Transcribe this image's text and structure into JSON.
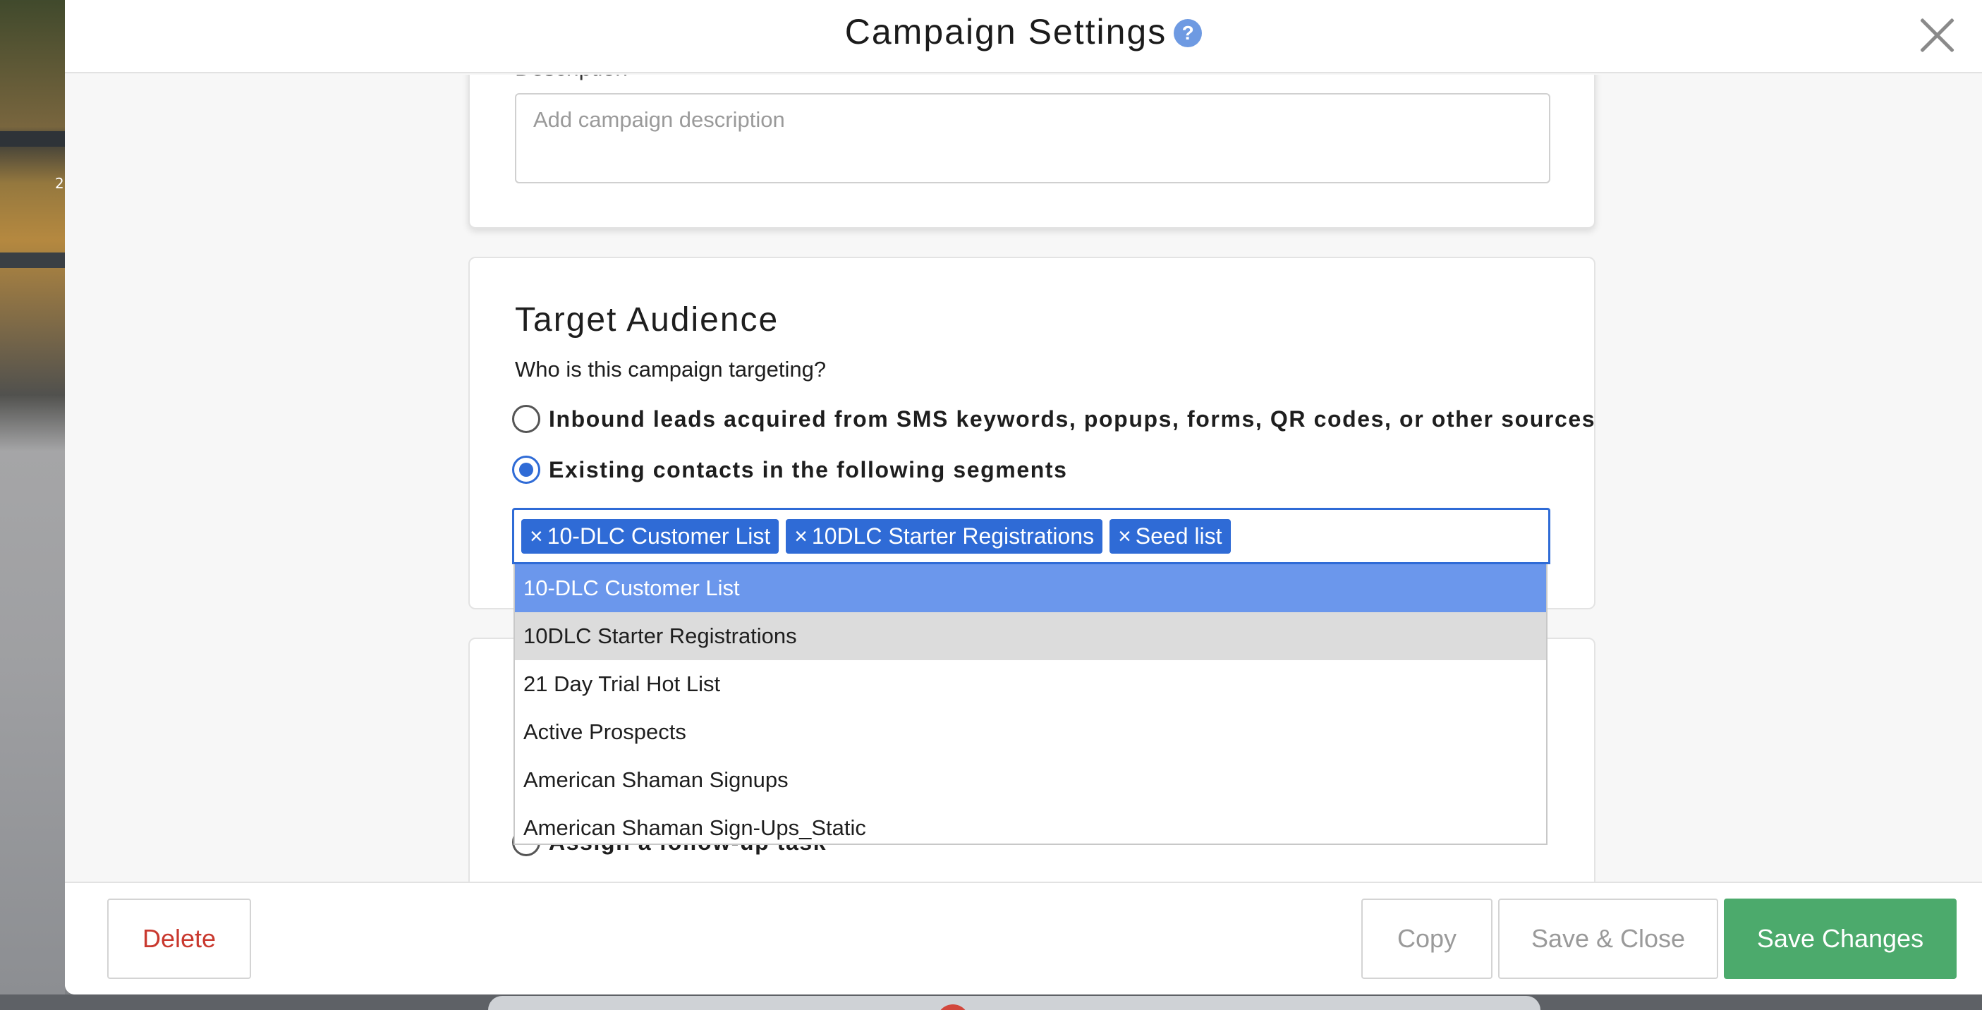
{
  "modal": {
    "title": "Campaign Settings",
    "help_glyph": "?"
  },
  "description": {
    "label": "Description",
    "placeholder": "Add campaign description",
    "value": ""
  },
  "target_audience": {
    "title": "Target Audience",
    "question": "Who is this campaign targeting?",
    "options": [
      {
        "label": "Inbound leads acquired from SMS keywords, popups, forms, QR codes, or other sources",
        "checked": false
      },
      {
        "label": "Existing contacts in the following segments",
        "checked": true
      }
    ],
    "selected_segments": [
      "10-DLC Customer List",
      "10DLC Starter Registrations",
      "Seed list"
    ],
    "tag_remove_glyph": "×",
    "dropdown_options": [
      "10-DLC Customer List",
      "10DLC Starter Registrations",
      "21 Day Trial Hot List",
      "Active Prospects",
      "American Shaman Signups",
      "American Shaman Sign-Ups_Static"
    ]
  },
  "followup": {
    "option_label": "Assign a follow-up task"
  },
  "footer": {
    "delete_label": "Delete",
    "copy_label": "Copy",
    "save_close_label": "Save & Close",
    "save_label": "Save Changes"
  },
  "colors": {
    "accent": "#2f6bd6",
    "highlight": "#6b97ec",
    "save_green": "#4caa6c",
    "delete_red": "#c9392f"
  }
}
